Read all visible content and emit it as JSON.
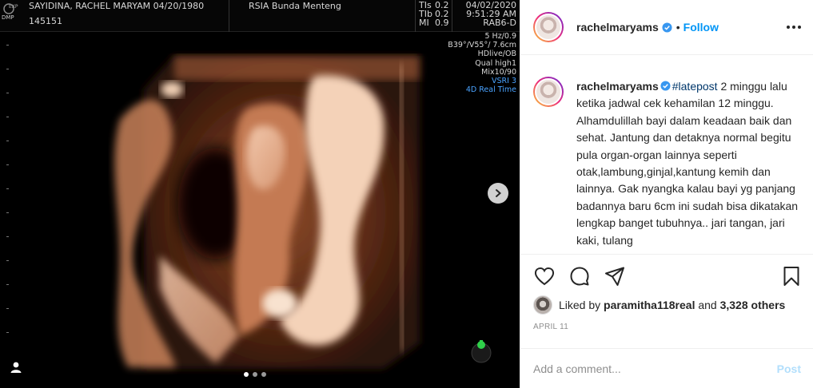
{
  "media": {
    "header": {
      "patient": "SAYIDINA, RACHEL MARYAM 04/20/1980",
      "patient_id": "145151",
      "clinic": "RSIA Bunda Menteng",
      "tis_label": "TIs",
      "tis_value": "0.2",
      "tib_label": "TIb",
      "tib_value": "0.2",
      "mi_label": "MI",
      "mi_value": "0.9",
      "date": "04/02/2020",
      "time": "9:51:29 AM",
      "probe": "RAB6-D",
      "logo_top": "EXP",
      "logo_bottom": "DMP"
    },
    "side_info": [
      "5 Hz/0.9",
      "B39°/V55°/ 7.6cm",
      "HDlive/OB",
      "Qual high1",
      "Mix10/90"
    ],
    "side_info_blue": [
      "VSRI 3",
      "4D Real Time"
    ],
    "carousel_dots": 3,
    "active_dot": 0
  },
  "post": {
    "username": "rachelmaryams",
    "follow_label": "Follow",
    "separator": "•",
    "caption_hashtag": "#latepost",
    "caption_text": " 2 minggu lalu ketika jadwal cek kehamilan 12 minggu. Alhamdulillah bayi dalam keadaan baik dan sehat. Jantung dan detaknya normal begitu pula organ-organ lainnya seperti otak,lambung,ginjal,kantung kemih dan lainnya. Gak nyangka kalau bayi yg panjang badannya baru 6cm ini sudah bisa dikatakan lengkap banget tubuhnya.. jari tangan, jari kaki, tulang",
    "liked_by_prefix": "Liked by",
    "liked_by_user": "paramitha118real",
    "liked_by_and": "and",
    "liked_by_others": "3,328 others",
    "date": "APRIL 11",
    "comment_placeholder": "Add a comment...",
    "post_button": "Post"
  },
  "colors": {
    "link_blue": "#0095f6",
    "verified_blue": "#3897f0",
    "post_disabled": "#b2dffc",
    "muted": "#8e8e8e"
  },
  "icons": {
    "like": "heart-icon",
    "comment": "comment-icon",
    "share": "paper-plane-icon",
    "save": "bookmark-icon",
    "more": "more-options-icon",
    "next": "chevron-right-icon"
  }
}
